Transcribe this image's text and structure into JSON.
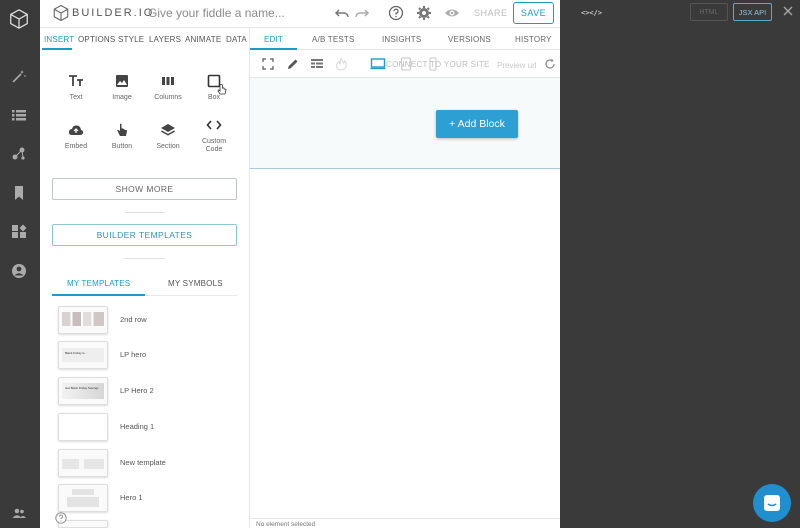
{
  "topbar": {
    "brand_name": "BUILDER.IO",
    "fiddle_placeholder": "Give your fiddle a name...",
    "share_label": "SHARE",
    "save_label": "SAVE"
  },
  "panel": {
    "tabs": [
      {
        "label": "INSERT",
        "active": true
      },
      {
        "label": "OPTIONS"
      },
      {
        "label": "STYLE"
      },
      {
        "label": "LAYERS"
      },
      {
        "label": "ANIMATE"
      },
      {
        "label": "DATA"
      }
    ],
    "blocks": [
      {
        "label": "Text",
        "icon": "text-icon"
      },
      {
        "label": "Image",
        "icon": "image-icon"
      },
      {
        "label": "Columns",
        "icon": "columns-icon"
      },
      {
        "label": "Box",
        "icon": "box-icon"
      },
      {
        "label": "Embed",
        "icon": "cloud-upload-icon"
      },
      {
        "label": "Button",
        "icon": "pointer-icon"
      },
      {
        "label": "Section",
        "icon": "layers-icon"
      },
      {
        "label": "Custom Code",
        "icon": "code-icon"
      }
    ],
    "show_more_label": "SHOW MORE",
    "builder_templates_label": "BUILDER TEMPLATES",
    "template_tabs": [
      {
        "label": "MY TEMPLATES",
        "active": true
      },
      {
        "label": "MY SYMBOLS"
      }
    ],
    "templates": [
      {
        "name": "2nd row",
        "thumb_text": ""
      },
      {
        "name": "LP hero",
        "thumb_text": "Black Friday is..."
      },
      {
        "name": "LP Hero 2",
        "thumb_text": "Get Black Friday Savings"
      },
      {
        "name": "Heading 1",
        "thumb_text": ""
      },
      {
        "name": "New template",
        "thumb_text": ""
      },
      {
        "name": "Hero 1",
        "thumb_text": ""
      }
    ]
  },
  "edit": {
    "tabs": [
      {
        "label": "EDIT",
        "active": true
      },
      {
        "label": "A/B TESTS"
      },
      {
        "label": "INSIGHTS"
      },
      {
        "label": "VERSIONS"
      },
      {
        "label": "HISTORY"
      }
    ],
    "connect_label": "CONNECT TO YOUR SITE",
    "preview_placeholder": "Preview url",
    "add_block_label": "+ Add Block",
    "status_text": "No element selected"
  },
  "code_pane": {
    "code_tag": "<></>",
    "html_label": "HTML",
    "jsx_label": "JSX API"
  },
  "colors": {
    "accent": "#1a9ec8",
    "add_block": "#2e9fd3",
    "rail": "#3a3a3a"
  }
}
